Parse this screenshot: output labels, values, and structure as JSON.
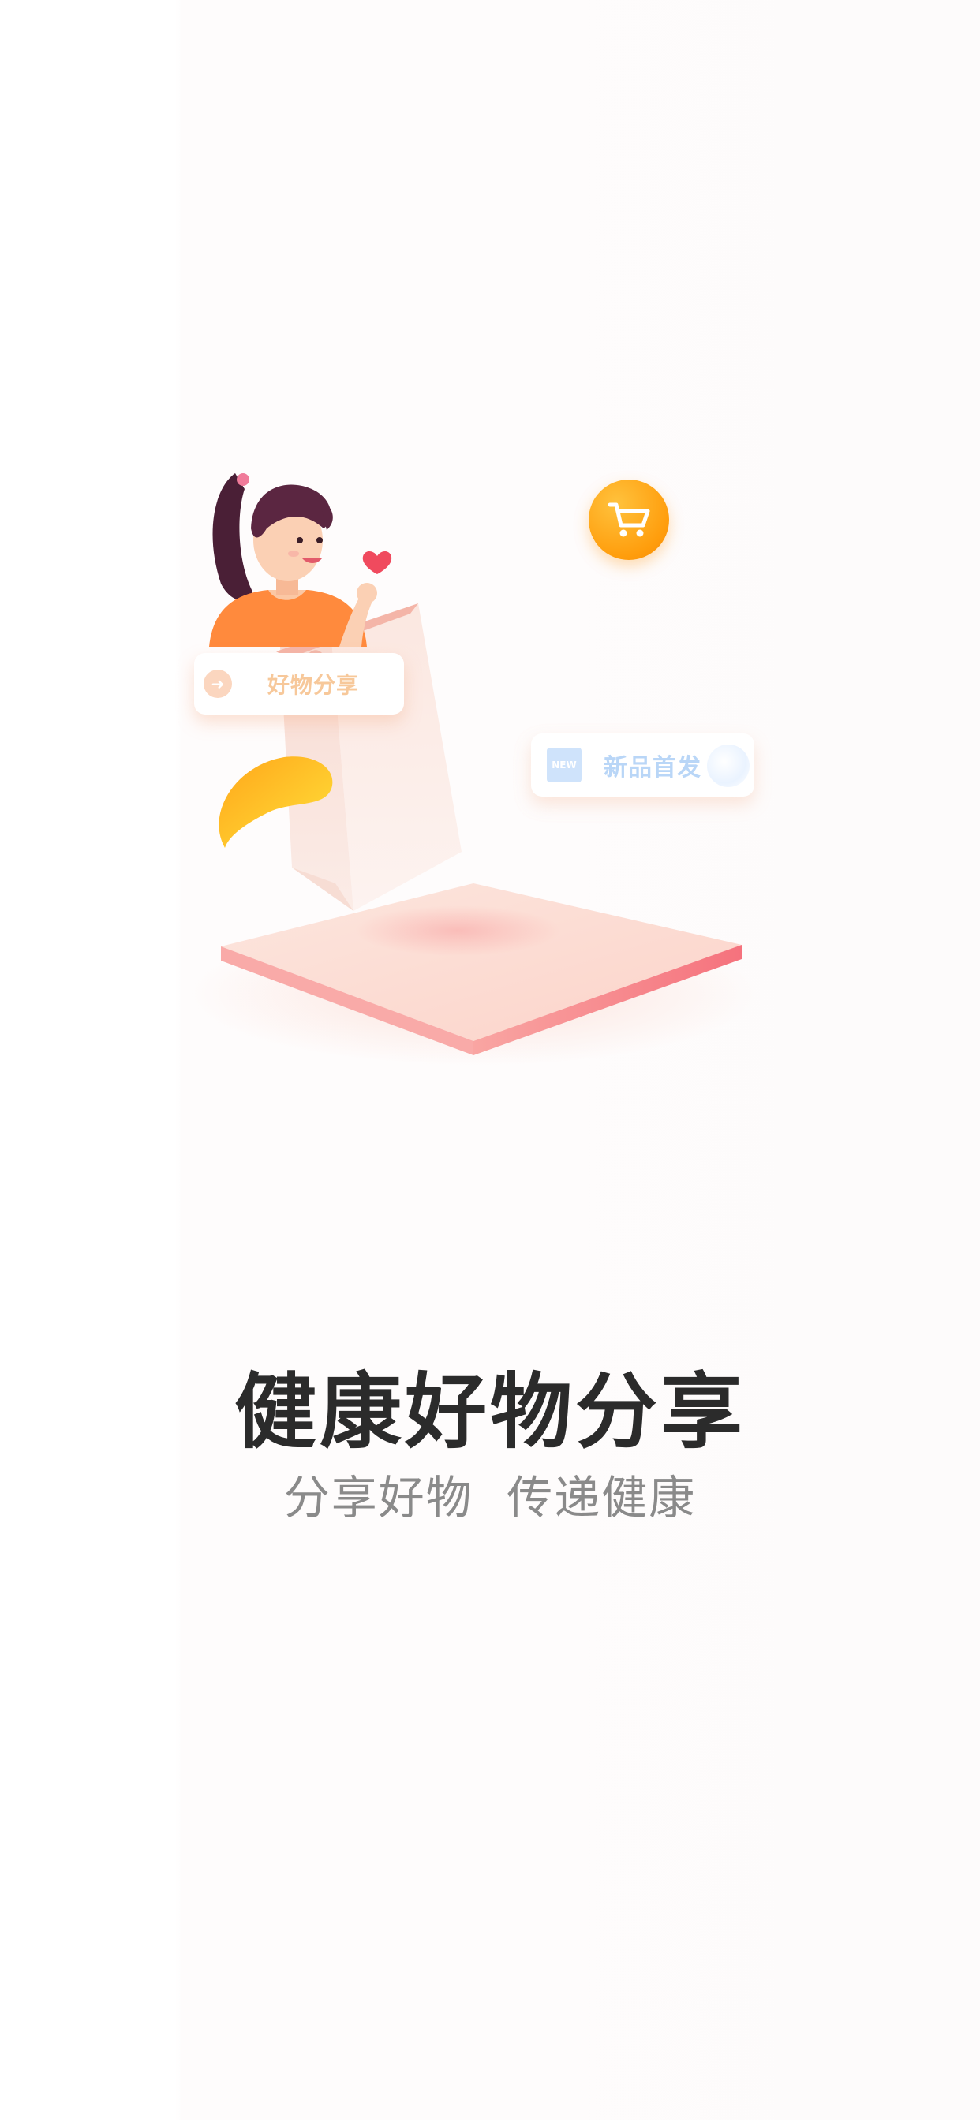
{
  "splash": {
    "title": "健康好物分享",
    "subtitle": "分享好物  传递健康"
  },
  "illustration": {
    "share_chip_label": "好物分享",
    "new_chip_label": "新品首发",
    "new_badge_text": "NEW",
    "icons": [
      "cart-icon",
      "heart-icon",
      "shopping-bag-icon",
      "new-badge-icon"
    ]
  },
  "colors": {
    "accent_orange": "#ff9d0c",
    "platform_pink": "#f88a8f",
    "title_text": "#2b2b2b",
    "subtitle_text": "#8a8a8a"
  }
}
